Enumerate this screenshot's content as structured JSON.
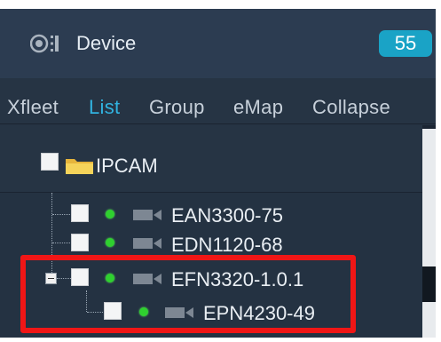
{
  "header": {
    "title": "Device",
    "count": "55",
    "icon": "device-tree-icon"
  },
  "tabs": [
    {
      "label": "Xfleet",
      "active": false
    },
    {
      "label": "List",
      "active": true
    },
    {
      "label": "Group",
      "active": false
    },
    {
      "label": "eMap",
      "active": false
    },
    {
      "label": "Collapse",
      "active": false
    }
  ],
  "tree": {
    "root": {
      "label": "IPCAM",
      "icon": "folder-icon"
    },
    "devices": [
      {
        "label": "EAN3300-75",
        "status": "online",
        "icon": "camera-icon"
      },
      {
        "label": "EDN1120-68",
        "status": "online",
        "icon": "camera-icon"
      },
      {
        "label": "EFN3320-1.0.1",
        "status": "online",
        "icon": "camera-icon",
        "expanded": true
      },
      {
        "label": "EPN4230-49",
        "status": "online",
        "icon": "camera-icon",
        "child_of": "EFN3320-1.0.1"
      }
    ]
  },
  "colors": {
    "accent": "#31b3e0",
    "badge": "#1aa3c6",
    "highlight": "#f01616",
    "online": "#2fd02f"
  }
}
